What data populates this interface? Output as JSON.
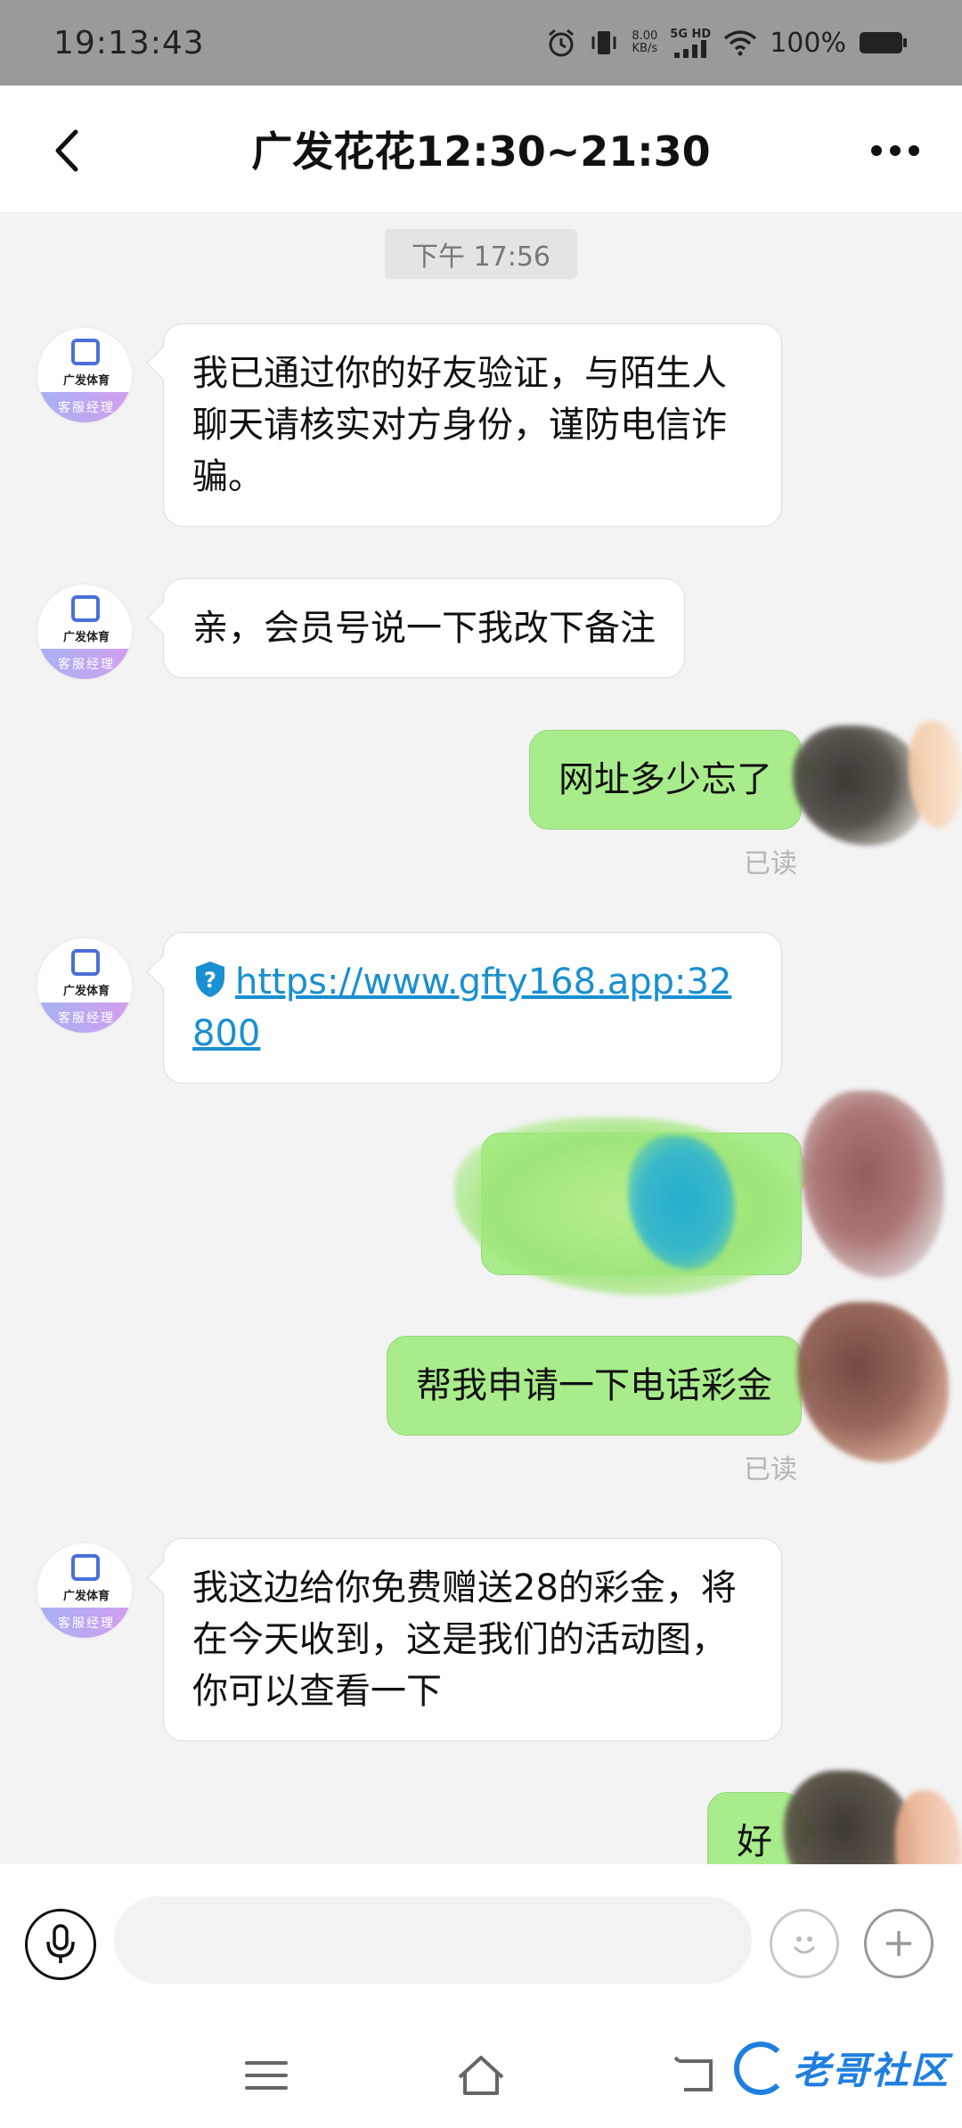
{
  "status_bar": {
    "time": "19:13:43",
    "net_speed_value": "8.00",
    "net_speed_unit": "KB/s",
    "signal_label": "5G HD",
    "battery_percent": "100%",
    "icons": [
      "alarm-icon",
      "vibrate-icon",
      "signal-icon",
      "wifi-icon",
      "battery-icon"
    ]
  },
  "header": {
    "title": "广发花花12:30~21:30",
    "back_icon": "chevron-left-icon",
    "more_icon": "more-dots-icon"
  },
  "chat": {
    "time_divider": "下午 17:56",
    "contact_avatar": {
      "brand": "广发体育",
      "band": "客服经理",
      "colors": [
        "#a7b2f2",
        "#d49ef0"
      ]
    },
    "messages": [
      {
        "dir": "in",
        "text": "我已通过你的好友验证，与陌生人聊天请核实对方身份，谨防电信诈骗。"
      },
      {
        "dir": "in",
        "text": "亲，会员号说一下我改下备注"
      },
      {
        "dir": "out",
        "text": "网址多少忘了",
        "status": "已读"
      },
      {
        "dir": "in",
        "type": "link",
        "text": "https://www.gfty168.app:32800"
      },
      {
        "dir": "out",
        "type": "redacted"
      },
      {
        "dir": "out",
        "text": "帮我申请一下电话彩金",
        "status": "已读"
      },
      {
        "dir": "in",
        "text": "我这边给你免费赠送28的彩金，将在今天收到，这是我们的活动图，你可以查看一下"
      },
      {
        "dir": "out",
        "text": "好"
      }
    ]
  },
  "input_bar": {
    "placeholder": "",
    "mic_icon": "microphone-icon",
    "emoji_icon": "emoji-icon",
    "plus_icon": "plus-icon"
  },
  "nav_bar": {
    "icons": [
      "menu-icon",
      "home-icon",
      "back-icon"
    ],
    "watermark": "老哥社区"
  },
  "colors": {
    "outgoing_bubble": "#a9ec8b",
    "incoming_bubble": "#ffffff",
    "link": "#1a8fd1",
    "status_bar_bg": "#9a9a9a"
  }
}
